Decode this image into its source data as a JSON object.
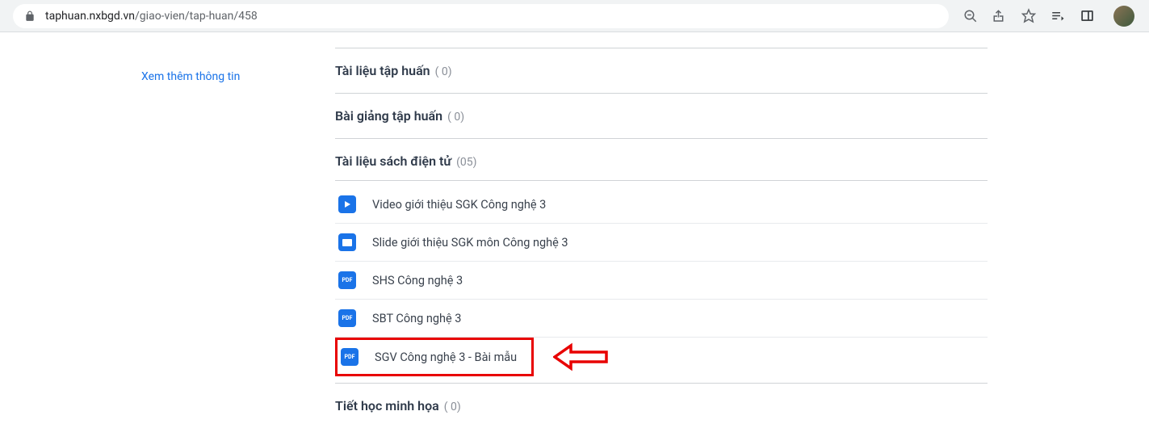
{
  "browser": {
    "url_host": "taphuan.nxbgd.vn",
    "url_path": "/giao-vien/tap-huan/458"
  },
  "sidebar": {
    "more_info_link": "Xem thêm thông tin"
  },
  "sections": [
    {
      "title": "Tài liệu tập huấn",
      "count": "( 0)"
    },
    {
      "title": "Bài giảng tập huấn",
      "count": "( 0)"
    },
    {
      "title": "Tài liệu sách điện tử",
      "count": "(05)"
    },
    {
      "title": "Tiết học minh họa",
      "count": "( 0)"
    }
  ],
  "documents": [
    {
      "icon_type": "video",
      "label": "Video giới thiệu SGK Công nghệ 3"
    },
    {
      "icon_type": "slide",
      "label": "Slide giới thiệu SGK môn Công nghệ 3"
    },
    {
      "icon_type": "pdf",
      "label": "SHS Công nghệ 3"
    },
    {
      "icon_type": "pdf",
      "label": "SBT Công nghệ 3"
    },
    {
      "icon_type": "pdf",
      "label": "SGV Công nghệ 3 - Bài mẫu",
      "highlighted": true
    }
  ],
  "icon_text": {
    "pdf": "PDF"
  }
}
